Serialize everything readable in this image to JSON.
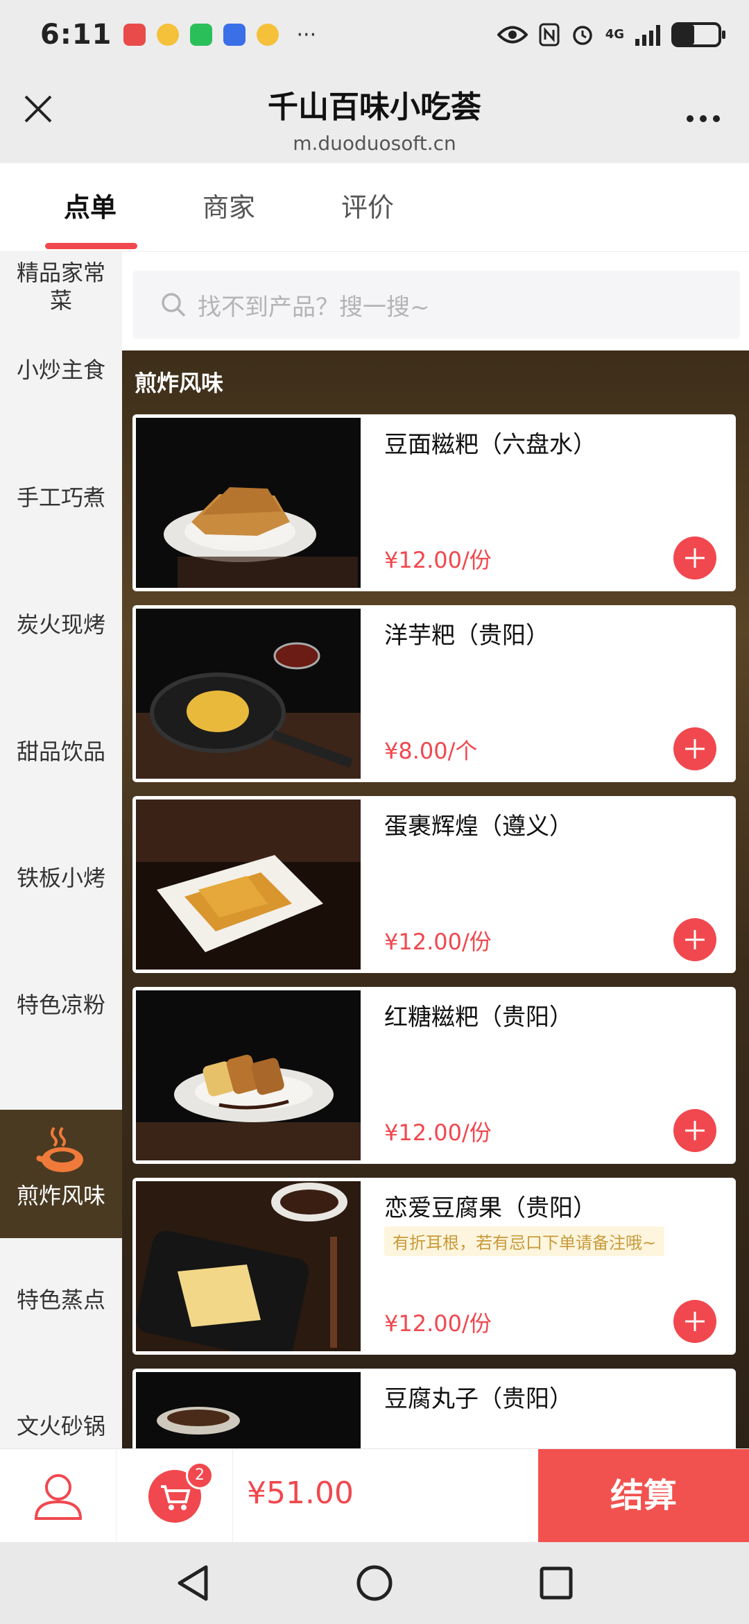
{
  "status": {
    "time": "6:11",
    "more": "···",
    "network": "4G"
  },
  "header": {
    "title": "千山百味小吃荟",
    "subtitle": "m.duoduosoft.cn",
    "close": "✕",
    "more": "···"
  },
  "tabs": [
    {
      "label": "点单"
    },
    {
      "label": "商家"
    },
    {
      "label": "评价"
    }
  ],
  "sidebar": {
    "items": [
      {
        "label": "精品家常菜"
      },
      {
        "label": "小炒主食"
      },
      {
        "label": "手工巧煮"
      },
      {
        "label": "炭火现烤"
      },
      {
        "label": "甜品饮品"
      },
      {
        "label": "铁板小烤"
      },
      {
        "label": "特色凉粉"
      },
      {
        "label": "煎炸风味"
      },
      {
        "label": "特色蒸点"
      },
      {
        "label": "文火砂锅"
      }
    ],
    "active_index": 7
  },
  "search": {
    "placeholder": "找不到产品？搜一搜~"
  },
  "category": {
    "title": "煎炸风味"
  },
  "products": [
    {
      "name": "豆面糍粑（六盘水）",
      "price": "¥12.00/份",
      "note": ""
    },
    {
      "name": "洋芋粑（贵阳）",
      "price": "¥8.00/个",
      "note": ""
    },
    {
      "name": "蛋裹辉煌（遵义）",
      "price": "¥12.00/份",
      "note": ""
    },
    {
      "name": "红糖糍粑（贵阳）",
      "price": "¥12.00/份",
      "note": ""
    },
    {
      "name": "恋爱豆腐果（贵阳）",
      "price": "¥12.00/份",
      "note": "有折耳根，若有忌口下单请备注哦~"
    },
    {
      "name": "豆腐丸子（贵阳）",
      "price": "",
      "note": ""
    }
  ],
  "cart": {
    "count": "2",
    "total": "¥51.00",
    "checkout": "结算"
  },
  "colors": {
    "accent": "#f0484e",
    "category_bg": "#4a3a22"
  }
}
